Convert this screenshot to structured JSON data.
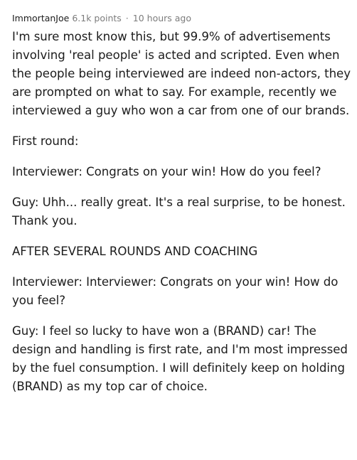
{
  "comment": {
    "author": "ImmortanJoe",
    "points": "6.1k points",
    "separator": "·",
    "time": "10 hours ago",
    "paragraphs": [
      "I'm sure most know this, but 99.9% of advertisements involving 'real people' is acted and scripted. Even when the people being interviewed are indeed non-actors, they are prompted on what to say. For example, recently we interviewed a guy who won a car from one of our brands.",
      "First round:",
      "Interviewer: Congrats on your win! How do you feel?",
      "Guy: Uhh... really great. It's a real surprise, to be honest. Thank you.",
      "AFTER SEVERAL ROUNDS AND COACHING",
      "Interviewer: Interviewer: Congrats on your win! How do you feel?",
      "Guy: I feel so lucky to have won a (BRAND) car! The design and handling is first rate, and I'm most impressed by the fuel consumption. I will definitely keep on holding (BRAND) as my top car of choice."
    ]
  }
}
